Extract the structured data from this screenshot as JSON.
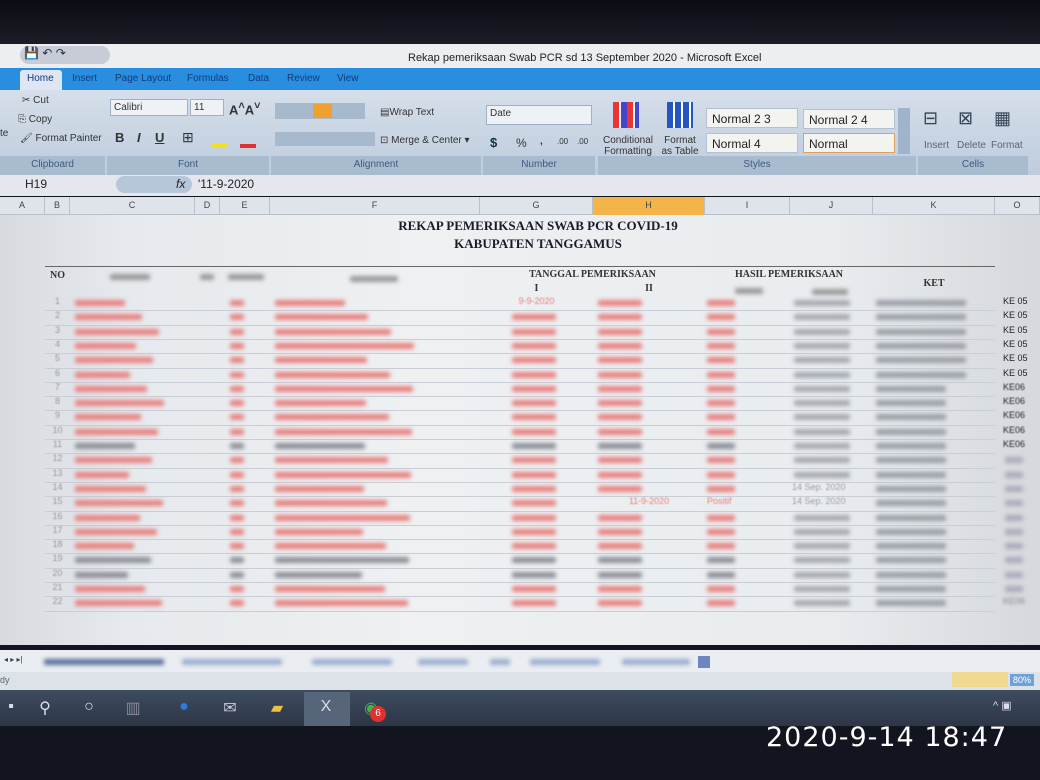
{
  "window": {
    "title": "Rekap pemeriksaan Swab PCR sd 13 September 2020 - Microsoft Excel"
  },
  "ribbon_tabs": [
    "Home",
    "Insert",
    "Page Layout",
    "Formulas",
    "Data",
    "Review",
    "View"
  ],
  "clipboard": {
    "cut": "Cut",
    "copy": "Copy",
    "format_painter": "Format Painter",
    "paste_partial": "te",
    "group": "Clipboard"
  },
  "font": {
    "name": "Calibri",
    "size": "11",
    "bold": "B",
    "italic": "I",
    "underline": "U",
    "group": "Font"
  },
  "alignment": {
    "wrap_text": "Wrap Text",
    "merge_center": "Merge & Center",
    "group": "Alignment"
  },
  "number": {
    "format": "Date",
    "currency": "$",
    "percent": "%",
    "comma": ",",
    "inc_decimal": ".00",
    "dec_decimal": ".00",
    "group": "Number"
  },
  "styles": {
    "conditional": "Conditional",
    "conditional2": "Formatting",
    "format_table": "Format",
    "format_table2": "as Table",
    "cells": [
      "Normal 2 3",
      "Normal 2 4",
      "Normal 4",
      "Normal"
    ],
    "group": "Styles"
  },
  "cells_group": {
    "insert": "Insert",
    "delete": "Delete",
    "format": "Format",
    "group": "Cells"
  },
  "formula_bar": {
    "name_box": "H19",
    "fx": "fx",
    "value": "'11-9-2020"
  },
  "columns": [
    "A",
    "B",
    "C",
    "D",
    "E",
    "F",
    "G",
    "H",
    "I",
    "J",
    "K",
    "O"
  ],
  "selected_column": "H",
  "sheet": {
    "title1": "REKAP PEMERIKSAAN SWAB PCR COVID-19",
    "title2": "KABUPATEN TANGGAMUS",
    "header_no": "NO",
    "header_tanggal": "TANGGAL PEMERIKSAAN",
    "header_tanggal_i": "I",
    "header_tanggal_ii": "II",
    "header_hasil": "HASIL PEMERIKSAAN",
    "header_ket": "KET",
    "rows": [
      {
        "no": "1",
        "g": "9-9-2020",
        "o": "KE 05",
        "red": true
      },
      {
        "no": "2",
        "o": "KE 05",
        "red": true
      },
      {
        "no": "3",
        "o": "KE 05",
        "red": true
      },
      {
        "no": "4",
        "o": "KE 05",
        "red": true
      },
      {
        "no": "5",
        "o": "KE 05",
        "red": true
      },
      {
        "no": "6",
        "o": "KE 05",
        "red": true
      },
      {
        "no": "7",
        "o": "KE06",
        "red": true
      },
      {
        "no": "8",
        "o": "KE06",
        "red": true
      },
      {
        "no": "9",
        "o": "KE06",
        "red": true
      },
      {
        "no": "10",
        "o": "KE06",
        "red": true
      },
      {
        "no": "11",
        "o": "KE06",
        "red": false
      },
      {
        "no": "12",
        "red": true
      },
      {
        "no": "13",
        "red": true
      },
      {
        "no": "14",
        "j": "14 Sep. 2020",
        "red": true
      },
      {
        "no": "15",
        "h": "11-9-2020",
        "i": "Positif",
        "j": "14 Sep. 2020",
        "red": true
      },
      {
        "no": "16",
        "red": true
      },
      {
        "no": "17",
        "red": true
      },
      {
        "no": "18",
        "red": true
      },
      {
        "no": "19",
        "red": false
      },
      {
        "no": "20",
        "red": false
      },
      {
        "no": "21",
        "red": true
      },
      {
        "no": "22",
        "o": "KE06",
        "red": true
      }
    ]
  },
  "status": {
    "ready_partial": "dy",
    "zoom": "80%"
  },
  "taskbar": {
    "whatsapp_badge": "6"
  },
  "photo_timestamp": "2020-9-14 18:47",
  "colors": {
    "accent": "#2a8ee0",
    "selected_col": "#f3b44a",
    "red_text": "#e8807f"
  }
}
